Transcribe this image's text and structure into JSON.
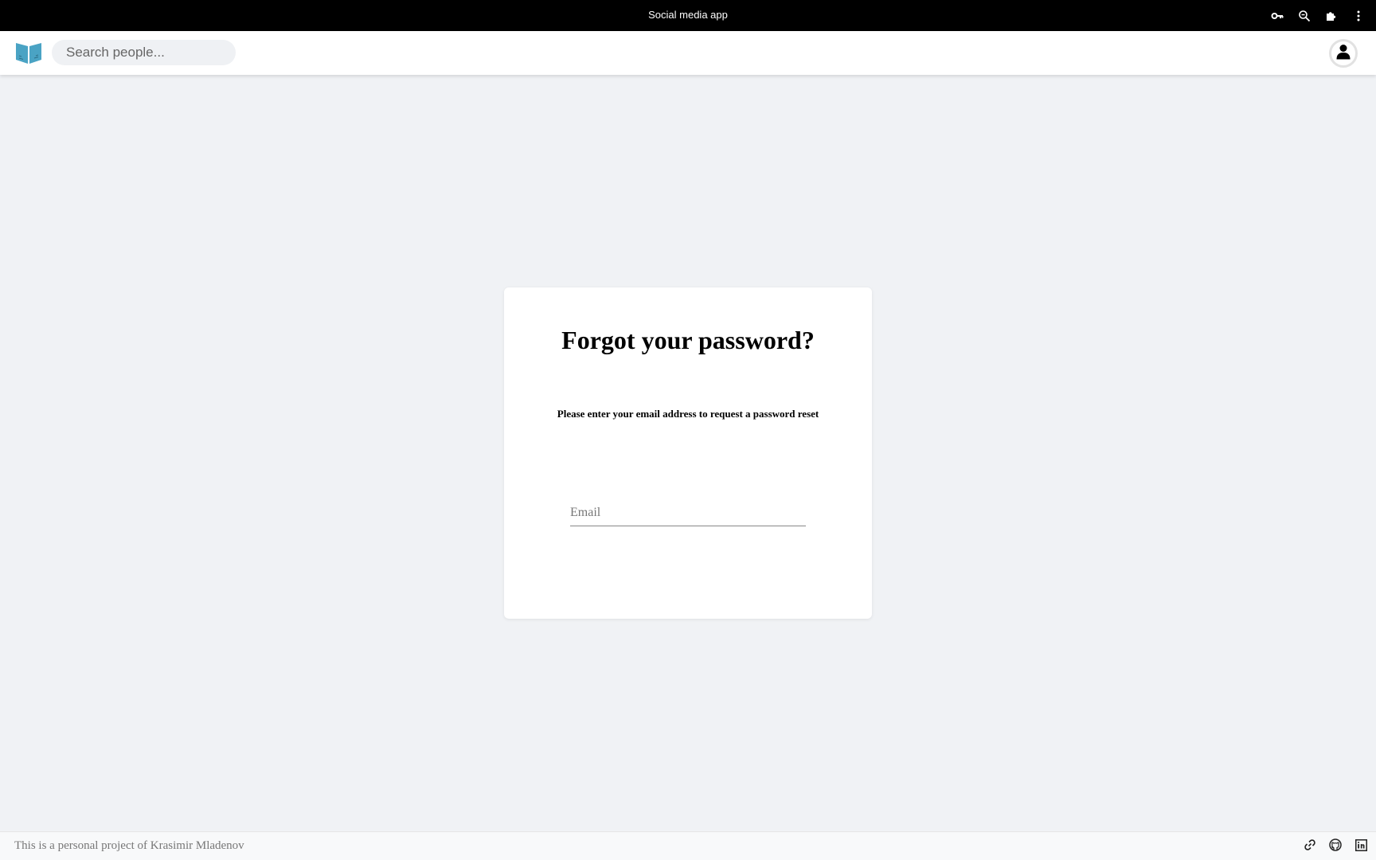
{
  "browser": {
    "title": "Social media app",
    "icons": [
      "key-icon",
      "zoom-icon",
      "extensions-icon",
      "more-vert-icon"
    ]
  },
  "header": {
    "search": {
      "placeholder": "Search people...",
      "value": ""
    },
    "logo_icon": "book-logo-icon",
    "avatar_icon": "user-icon"
  },
  "card": {
    "title": "Forgot your password?",
    "subtitle": "Please enter your email address to request a password reset",
    "email": {
      "placeholder": "Email",
      "value": ""
    }
  },
  "footer": {
    "text": "This is a personal project of Krasimir Mladenov",
    "icons": [
      "link-icon",
      "github-icon",
      "linkedin-icon"
    ]
  },
  "colors": {
    "background": "#f0f2f5",
    "logo": "#4aa3c4",
    "browser_bar": "#000000"
  }
}
